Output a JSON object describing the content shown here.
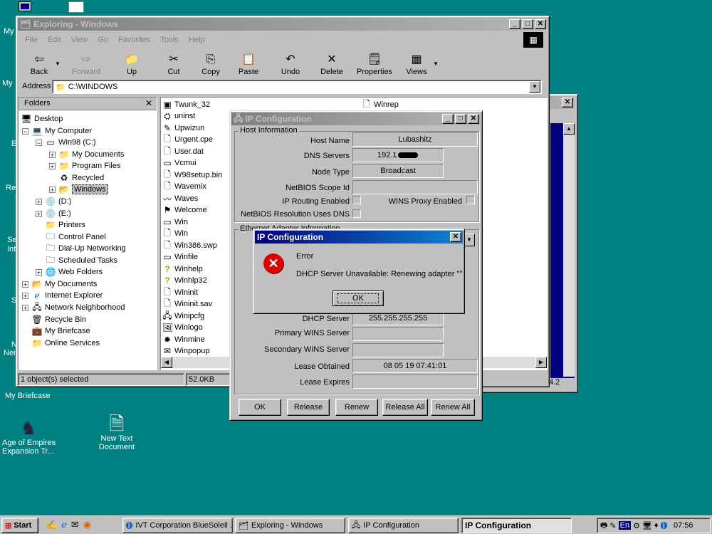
{
  "desktop": {
    "icons": [
      {
        "label": "My Briefcase"
      },
      {
        "label": "Age of Empires Expansion Tr..."
      },
      {
        "label": "New Text Document"
      }
    ],
    "partial_labels": [
      "My",
      "My",
      "E",
      "Re",
      "Se",
      "Int",
      "S",
      "N",
      "Nei"
    ]
  },
  "explorer": {
    "title": "Exploring - Windows",
    "menu": [
      "File",
      "Edit",
      "View",
      "Go",
      "Favorites",
      "Tools",
      "Help"
    ],
    "toolbar": [
      "Back",
      "Forward",
      "Up",
      "Cut",
      "Copy",
      "Paste",
      "Undo",
      "Delete",
      "Properties",
      "Views"
    ],
    "address_label": "Address",
    "address_value": "C:\\WINDOWS",
    "folders_header": "Folders",
    "tree": [
      "Desktop",
      "My Computer",
      "Win98 (C:)",
      "My Documents",
      "Program Files",
      "Recycled",
      "Windows",
      "(D:)",
      "(E:)",
      "Printers",
      "Control Panel",
      "Dial-Up Networking",
      "Scheduled Tasks",
      "Web Folders",
      "My Documents",
      "Internet Explorer",
      "Network Neighborhood",
      "Recycle Bin",
      "My Briefcase",
      "Online Services"
    ],
    "files": [
      "Twunk_32",
      "uninst",
      "Upwizun",
      "Urgent.cpe",
      "User.dat",
      "Vcmui",
      "W98setup.bin",
      "Wavemix",
      "Waves",
      "Welcome",
      "Win",
      "Win",
      "Win386.swp",
      "Winfile",
      "Winhelp",
      "Winhlp32",
      "Wininit",
      "Wininit.sav",
      "Winipcfg",
      "Winlogo",
      "Winmine",
      "Winpopup"
    ],
    "file_right": "Winrep",
    "status_left": "1 object(s) selected",
    "status_size": "52.0KB",
    "status_right": "4.2"
  },
  "ipconfig": {
    "title": "IP Configuration",
    "host_info_label": "Host Information",
    "host_name_label": "Host Name",
    "host_name": "Lubashitz",
    "dns_label": "DNS Servers",
    "dns_value": "192.1",
    "node_type_label": "Node Type",
    "node_type": "Broadcast",
    "netbios_scope_label": "NetBIOS Scope Id",
    "ip_routing_label": "IP Routing Enabled",
    "wins_proxy_label": "WINS Proxy Enabled",
    "netbios_resolution_label": "NetBIOS Resolution Uses DNS",
    "adapter_group_label": "Ethernet Adapter Information",
    "dhcp_server_label": "DHCP Server",
    "dhcp_server": "255.255.255.255",
    "primary_wins_label": "Primary WINS Server",
    "secondary_wins_label": "Secondary WINS Server",
    "lease_obtained_label": "Lease Obtained",
    "lease_obtained": "08 05 19 07:41:01",
    "lease_expires_label": "Lease Expires",
    "buttons": [
      "OK",
      "Release",
      "Renew",
      "Release All",
      "Renew All"
    ]
  },
  "error_dialog": {
    "title": "IP Configuration",
    "heading": "Error",
    "message": "DHCP Server Unavailable: Renewing adapter \"\"",
    "ok": "OK"
  },
  "taskbar": {
    "start": "Start",
    "tasks": [
      "IVT Corporation BlueSoleil ...",
      "Exploring - Windows",
      "IP Configuration",
      "IP Configuration"
    ],
    "lang": "En",
    "clock": "07:56"
  },
  "colors": {
    "desktop": "#008080",
    "title_active": "#000080",
    "face": "#c0c0c0",
    "error_red": "#e00000"
  }
}
